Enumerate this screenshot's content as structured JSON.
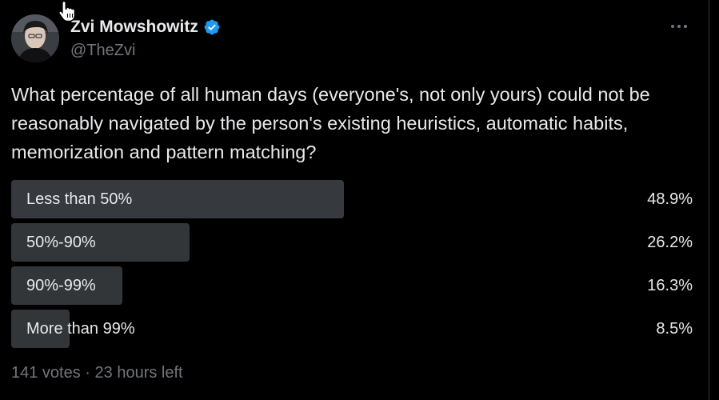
{
  "author": {
    "name": "Zvi Mowshowitz",
    "handle": "@TheZvi",
    "verified": true,
    "avatar_icon": "avatar-icon",
    "verified_color": "#1d9bf0"
  },
  "post": {
    "question": "What percentage of all human days (everyone's, not only yours) could not be reasonably navigated by the person's existing heuristics, automatic habits, memorization and pattern matching?"
  },
  "poll": {
    "options": [
      {
        "label": "Less than 50%",
        "percent": "48.9%",
        "value": 48.9,
        "winner": true
      },
      {
        "label": "50%-90%",
        "percent": "26.2%",
        "value": 26.2,
        "winner": false
      },
      {
        "label": "90%-99%",
        "percent": "16.3%",
        "value": 16.3,
        "winner": false
      },
      {
        "label": "More than 99%",
        "percent": "8.5%",
        "value": 8.5,
        "winner": false
      }
    ],
    "votes": "141 votes",
    "separator": "·",
    "time_left": "23 hours left"
  },
  "colors": {
    "background": "#000000",
    "text": "#e7e9ea",
    "muted": "#71767b",
    "bar": "#333639"
  }
}
